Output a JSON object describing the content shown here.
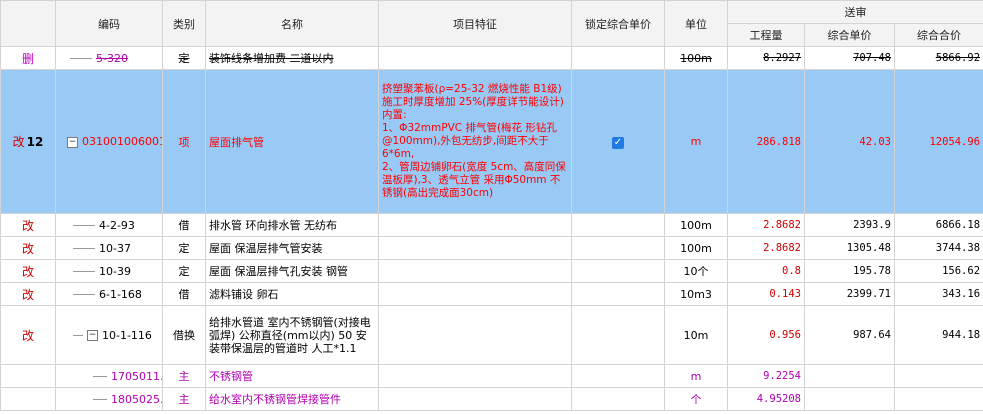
{
  "headers": {
    "code": "编码",
    "type": "类别",
    "name": "名称",
    "feature": "项目特征",
    "lock_price": "锁定综合单价",
    "unit": "单位",
    "group": "送审",
    "quantity": "工程量",
    "unit_price": "综合单价",
    "total_price": "综合合价"
  },
  "rows": [
    {
      "mark": "删",
      "code": "5-320",
      "type": "定",
      "name": "装饰线条增加费 二道以内",
      "feature": "",
      "unit": "100m",
      "quantity": "8.2927",
      "unit_price": "707.48",
      "total_price": "5866.92"
    },
    {
      "mark": "改",
      "index": "12",
      "code": "031001006001",
      "type": "项",
      "name": "屋面排气管",
      "feature": "挤塑聚苯板(ρ=25-32 燃烧性能 B1级)施工时厚度增加 25%(厚度详节能设计)内置:\n1、Φ32mmPVC 排气管(梅花 形钻孔@100mm),外包无纺步,间距不大于 6*6m,\n2、管周边铺卵石(宽度 5cm、高度同保温板厚),3、透气立管 采用Φ50mm 不锈钢(高出完成面30cm)",
      "lock": "checked",
      "unit": "m",
      "quantity": "286.818",
      "unit_price": "42.03",
      "total_price": "12054.96"
    },
    {
      "mark": "改",
      "code": "4-2-93",
      "type": "借",
      "name": "排水管 环向排水管 无纺布",
      "feature": "",
      "unit": "100m",
      "quantity": "2.8682",
      "unit_price": "2393.9",
      "total_price": "6866.18"
    },
    {
      "mark": "改",
      "code": "10-37",
      "type": "定",
      "name": "屋面 保温层排气管安装",
      "feature": "",
      "unit": "100m",
      "quantity": "2.8682",
      "unit_price": "1305.48",
      "total_price": "3744.38"
    },
    {
      "mark": "改",
      "code": "10-39",
      "type": "定",
      "name": "屋面 保温层排气孔安装 钢管",
      "feature": "",
      "unit": "10个",
      "quantity": "0.8",
      "unit_price": "195.78",
      "total_price": "156.62"
    },
    {
      "mark": "改",
      "code": "6-1-168",
      "type": "借",
      "name": "滤料铺设 卵石",
      "feature": "",
      "unit": "10m3",
      "quantity": "0.143",
      "unit_price": "2399.71",
      "total_price": "343.16"
    },
    {
      "mark": "改",
      "code": "10-1-116",
      "type": "借换",
      "name": "给排水管道 室内不锈钢管(对接电弧焊) 公称直径(mm以内) 50 安装带保温层的管道时 人工*1.1",
      "feature": "",
      "unit": "10m",
      "quantity": "0.956",
      "unit_price": "987.64",
      "total_price": "944.18"
    },
    {
      "mark": "",
      "code": "1705011…",
      "type": "主",
      "name": "不锈钢管",
      "feature": "",
      "unit": "m",
      "quantity": "9.2254",
      "unit_price": "",
      "total_price": ""
    },
    {
      "mark": "",
      "code": "1805025…",
      "type": "主",
      "name": "给水室内不锈钢管焊接管件",
      "feature": "",
      "unit": "个",
      "quantity": "4.95208",
      "unit_price": "",
      "total_price": ""
    }
  ]
}
